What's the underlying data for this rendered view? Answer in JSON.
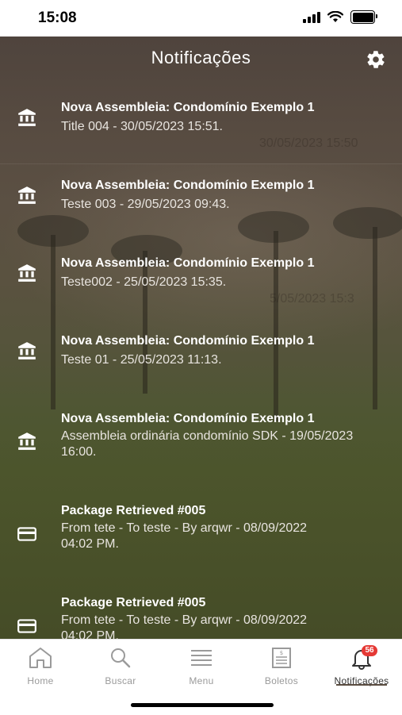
{
  "status_bar": {
    "time": "15:08"
  },
  "header": {
    "title": "Notificações"
  },
  "notifications": [
    {
      "icon": "bank-icon",
      "title": "Nova Assembleia: Condomínio Exemplo 1",
      "body": "Title 004 - 30/05/2023 15:51."
    },
    {
      "icon": "bank-icon",
      "title": "Nova Assembleia: Condomínio Exemplo 1",
      "body": "Teste 003 - 29/05/2023 09:43."
    },
    {
      "icon": "bank-icon",
      "title": "Nova Assembleia: Condomínio Exemplo 1",
      "body": "Teste002 - 25/05/2023 15:35."
    },
    {
      "icon": "bank-icon",
      "title": "Nova Assembleia: Condomínio Exemplo 1",
      "body": "Teste 01 - 25/05/2023 11:13."
    },
    {
      "icon": "bank-icon",
      "title": "Nova Assembleia: Condomínio Exemplo 1",
      "body": "Assembleia ordinária condomínio SDK - 19/05/2023 16:00."
    },
    {
      "icon": "card-icon",
      "title": "Package Retrieved #005",
      "body": "From tete - To teste - By arqwr - 08/09/2022 04:02 PM."
    },
    {
      "icon": "card-icon",
      "title": "Package Retrieved #005",
      "body": "From tete - To teste - By arqwr - 08/09/2022 04:02 PM."
    }
  ],
  "background_ghost_text": {
    "first": "30/05/2023 15:50",
    "second": "5/05/2023 15:3"
  },
  "tabbar": {
    "tabs": [
      {
        "label": "Home",
        "icon": "home-icon"
      },
      {
        "label": "Buscar",
        "icon": "search-icon"
      },
      {
        "label": "Menu",
        "icon": "menu-icon"
      },
      {
        "label": "Boletos",
        "icon": "invoice-icon"
      },
      {
        "label": "Notificações",
        "icon": "bell-icon"
      }
    ],
    "badge_count": "56"
  },
  "colors": {
    "accent": "#5a4c40",
    "badge": "#e53935"
  }
}
